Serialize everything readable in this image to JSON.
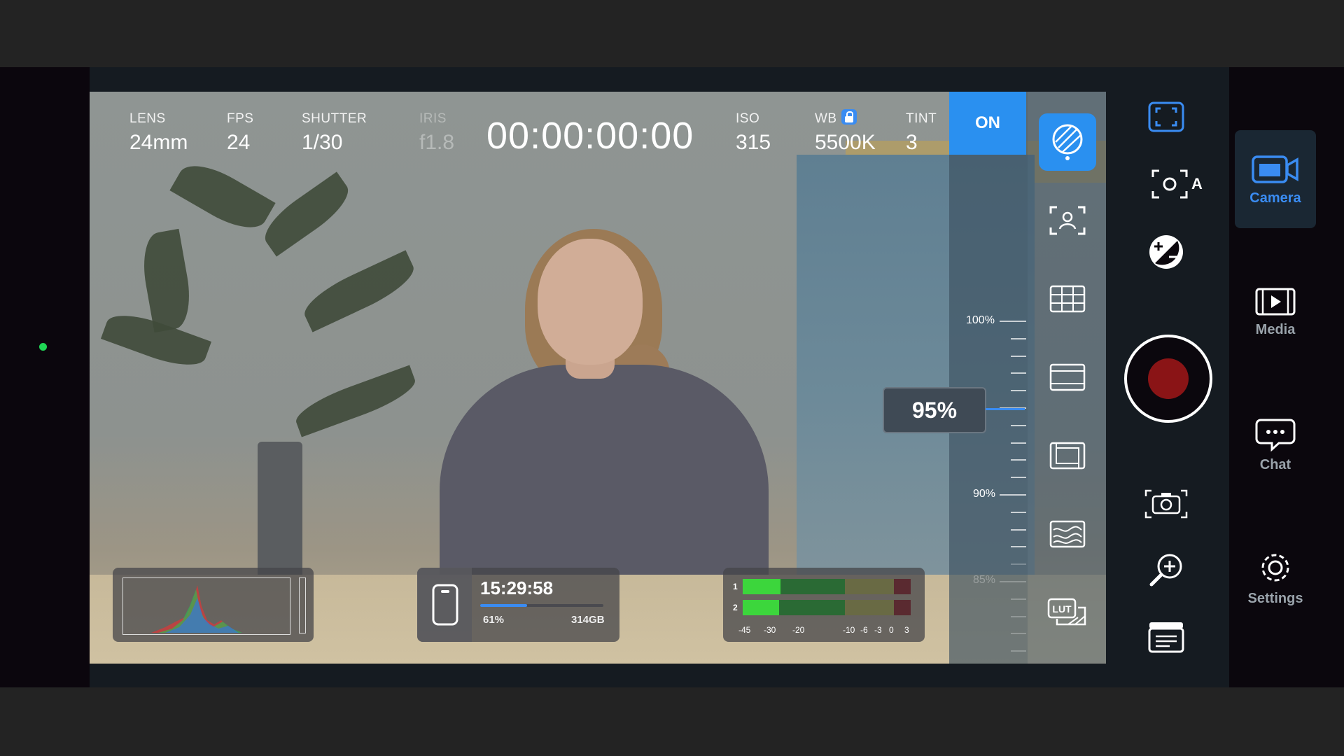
{
  "hud": {
    "lens": {
      "label": "LENS",
      "value": "24mm"
    },
    "fps": {
      "label": "FPS",
      "value": "24"
    },
    "shutter": {
      "label": "SHUTTER",
      "value": "1/30"
    },
    "iris": {
      "label": "IRIS",
      "value": "f1.8"
    },
    "timecode": "00:00:00:00",
    "iso": {
      "label": "ISO",
      "value": "315"
    },
    "wb": {
      "label": "WB",
      "value": "5500K"
    },
    "tint": {
      "label": "TINT",
      "value": "3"
    }
  },
  "zoom": {
    "on_label": "ON",
    "current": "95%",
    "scale": [
      "100%",
      "90%",
      "85%"
    ]
  },
  "recording": {
    "remaining_time": "15:29:58",
    "battery": "61%",
    "storage": "314GB",
    "fill_fraction": 0.38
  },
  "audio_meter": {
    "channels": [
      "1",
      "2"
    ],
    "scale": [
      "-45",
      "-30",
      "-20",
      "-10",
      "-6",
      "-3",
      "0",
      "3"
    ]
  },
  "tools": [
    {
      "name": "zebra-icon",
      "active": true
    },
    {
      "name": "face-detect-icon",
      "active": false
    },
    {
      "name": "grid-icon",
      "active": false
    },
    {
      "name": "frame-guide-icon",
      "active": false
    },
    {
      "name": "crop-guide-icon",
      "active": false
    },
    {
      "name": "false-color-icon",
      "active": false
    },
    {
      "name": "lut-icon",
      "active": false,
      "text": "LUT"
    }
  ],
  "controls": {
    "autofocus_label": "A"
  },
  "nav": [
    {
      "label": "Camera",
      "icon": "camera-icon",
      "active": true
    },
    {
      "label": "Media",
      "icon": "media-icon",
      "active": false
    },
    {
      "label": "Chat",
      "icon": "chat-icon",
      "active": false
    },
    {
      "label": "Settings",
      "icon": "gear-icon",
      "active": false
    }
  ],
  "colors": {
    "accent": "#2a90f0",
    "record": "#8a1416",
    "status_dot": "#1fd655",
    "meter_green": "#3cd63c"
  }
}
